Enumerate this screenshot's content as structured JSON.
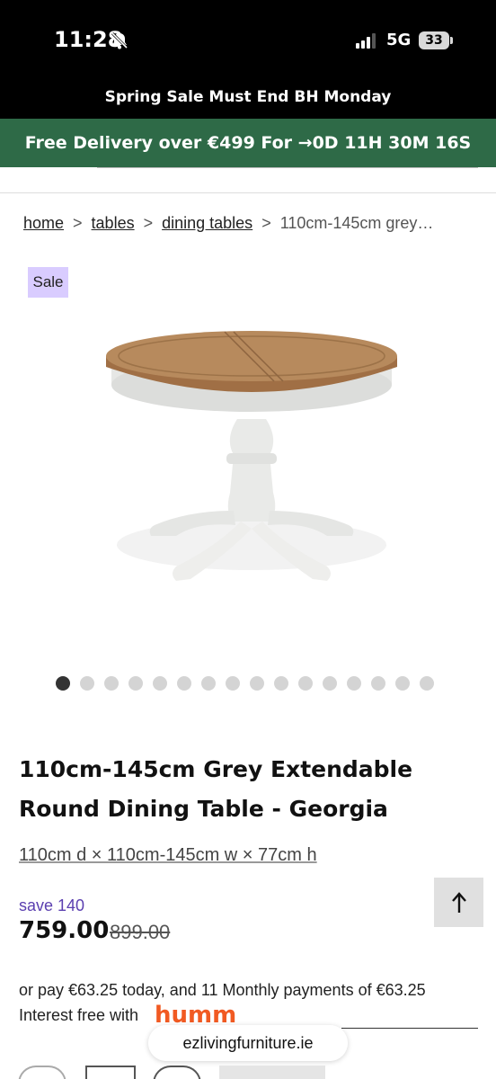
{
  "status_bar": {
    "time": "11:28",
    "network": "5G",
    "battery": "33",
    "icons": [
      "bell-slash-icon",
      "signal-icon"
    ]
  },
  "promo": {
    "text": "Spring Sale Must End BH Monday"
  },
  "delivery": {
    "text": "Free Delivery over €499 For →0D 11H 30M 16S"
  },
  "breadcrumb": {
    "home": "home",
    "tables": "tables",
    "dining_tables": "dining tables",
    "separator": ">",
    "current": "110cm-145cm grey…"
  },
  "badge": {
    "sale": "Sale"
  },
  "gallery": {
    "image_count": 16,
    "active_index": 0
  },
  "product": {
    "title": "110cm-145cm Grey Extendable Round Dining Table - Georgia",
    "dimensions": "110cm d × 110cm-145cm w × 77cm h",
    "save": "save 140",
    "price": "759.00",
    "old_price": "899.00"
  },
  "finance": {
    "line": "or pay €63.25 today, and 11 Monthly payments of €63.25 Interest free with",
    "provider": "humm"
  },
  "browser": {
    "url": "ezlivingfurniture.ie"
  },
  "colors": {
    "delivery_bg": "#2e6a47",
    "badge_bg": "#d9ccff",
    "save_text": "#5b3fb0"
  }
}
